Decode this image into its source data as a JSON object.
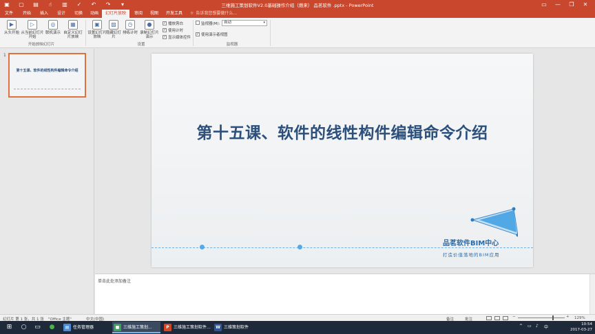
{
  "window": {
    "title": "三维施工策划软件V2.0基础操作介绍（燃来） 品茗软件 .pptx - PowerPoint",
    "controls": {
      "minimize": "—",
      "restore": "❐",
      "close": "✕",
      "ribbon_opts": "▭"
    }
  },
  "qat": [
    {
      "icon": "save-icon",
      "glyph": "▣"
    },
    {
      "icon": "new-icon",
      "glyph": "▢"
    },
    {
      "icon": "open-icon",
      "glyph": "▤"
    },
    {
      "icon": "touch-icon",
      "glyph": "☝"
    },
    {
      "icon": "new-slide-icon",
      "glyph": "▥"
    },
    {
      "icon": "spell-icon",
      "glyph": "✓"
    },
    {
      "icon": "undo-icon",
      "glyph": "↶"
    },
    {
      "icon": "redo-icon",
      "glyph": "↷"
    },
    {
      "icon": "customize-icon",
      "glyph": "▾"
    }
  ],
  "tabs": [
    "文件",
    "开始",
    "插入",
    "设计",
    "切换",
    "动画",
    "幻灯片放映",
    "审阅",
    "视图",
    "开发工具"
  ],
  "active_tab": 6,
  "tellme": {
    "icon": "lightbulb-icon",
    "glyph": "☼",
    "text": "告诉我您想要做什么..."
  },
  "ribbon": {
    "buttons": [
      {
        "label": "从头开始",
        "glyph": "▶"
      },
      {
        "label": "从当前幻灯片开始",
        "glyph": "▷"
      },
      {
        "label": "联机演示",
        "glyph": "◎"
      },
      {
        "label": "自定义幻灯片放映",
        "glyph": "▦"
      },
      {
        "label": "设置幻灯片放映",
        "glyph": "▣"
      },
      {
        "label": "隐藏幻灯片",
        "glyph": "▨"
      },
      {
        "label": "排练计时",
        "glyph": "◷"
      },
      {
        "label": "录制幻灯片演示",
        "glyph": "●"
      }
    ],
    "groups": {
      "start": "开始放映幻灯片",
      "setup": "设置",
      "monitors": "监视器"
    },
    "checks": [
      {
        "label": "播放旁白",
        "checked": true
      },
      {
        "label": "使用计时",
        "checked": true
      },
      {
        "label": "显示媒体控件",
        "checked": true
      }
    ],
    "monitor": {
      "label": "监视器(M):",
      "value": "自动",
      "presenter_label": "使用演示者视图",
      "presenter_checked": true
    }
  },
  "thumbnails": [
    {
      "number": "1",
      "title": "第十五课、软件的线性构件编辑命令介绍"
    }
  ],
  "slide": {
    "title": "第十五课、软件的线性构件编辑命令介绍",
    "brand": "品茗软件BIM中心",
    "brand_sub": "打造价值落地的BIM应用",
    "colors": {
      "title": "#2c4f7c",
      "accent": "#58a8e3"
    }
  },
  "notes": {
    "placeholder": "单击此处添加备注"
  },
  "statusbar": {
    "slide_info": "幻灯片 第 1 张，共 1 张",
    "theme": "\"Office 主题\"",
    "language": "中文(中国)",
    "notes_btn": "备注",
    "comments_btn": "批注",
    "zoom_out": "−",
    "zoom_in": "+",
    "zoom": "129%"
  },
  "taskbar": {
    "tasks": [
      {
        "label": "任务管理器",
        "icon": "task-manager-icon",
        "glyph": "▤",
        "color": "#4a8bd1"
      },
      {
        "label": "三维施工策划...",
        "icon": "app-icon",
        "glyph": "■",
        "color": "#3aa35a"
      },
      {
        "label": "三维施工策划软件...",
        "icon": "powerpoint-icon",
        "glyph": "P",
        "color": "#d24726"
      },
      {
        "label": "三维策划软件v2.0...",
        "icon": "word-icon",
        "glyph": "W",
        "color": "#2b579a"
      }
    ],
    "time": "10:54",
    "date": "2017-03-27"
  }
}
